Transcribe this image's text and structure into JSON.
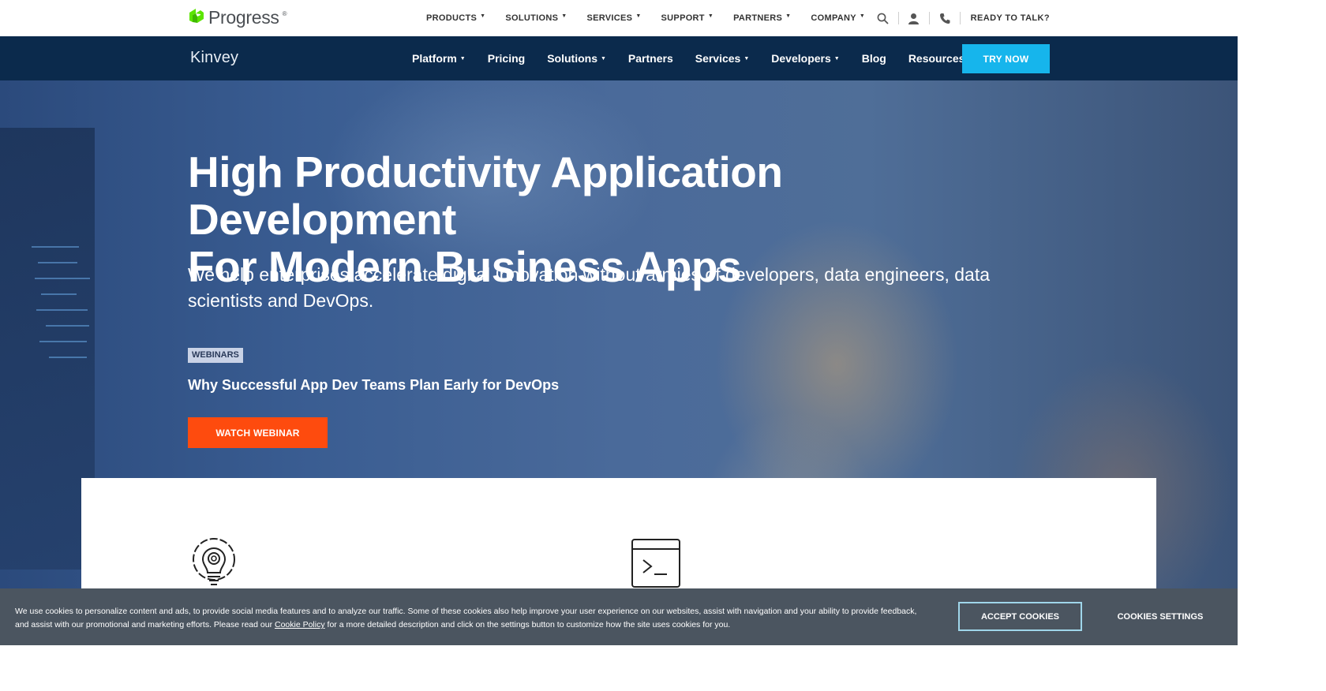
{
  "brand": {
    "logo_text": "Progress",
    "logo_mark": "®",
    "product_name": "Kinvey"
  },
  "top_nav": {
    "items": [
      {
        "label": "PRODUCTS"
      },
      {
        "label": "SOLUTIONS"
      },
      {
        "label": "SERVICES"
      },
      {
        "label": "SUPPORT"
      },
      {
        "label": "PARTNERS"
      },
      {
        "label": "COMPANY"
      }
    ],
    "icons": [
      "search-icon",
      "user-icon",
      "phone-icon"
    ],
    "ready_label": "READY TO TALK?"
  },
  "product_nav": {
    "items": [
      {
        "label": "Platform",
        "has_caret": true
      },
      {
        "label": "Pricing",
        "has_caret": false
      },
      {
        "label": "Solutions",
        "has_caret": true
      },
      {
        "label": "Partners",
        "has_caret": false
      },
      {
        "label": "Services",
        "has_caret": true
      },
      {
        "label": "Developers",
        "has_caret": true
      },
      {
        "label": "Blog",
        "has_caret": false
      },
      {
        "label": "Resources",
        "has_caret": true
      }
    ],
    "cta_label": "TRY NOW"
  },
  "hero": {
    "title_line1": "High Productivity Application Development",
    "title_line2": "For Modern Business Apps",
    "subtitle": "We help enterprises accelerate digital innovation without armies of developers, data engineers, data scientists and DevOps.",
    "badge": "WEBINARS",
    "webinar_title": "Why Successful App Dev Teams Plan Early for DevOps",
    "cta_label": "WATCH WEBINAR"
  },
  "cookie_banner": {
    "text_before_link": "We use cookies to personalize content and ads, to provide social media features and to analyze our traffic. Some of these cookies also help improve your user experience on our websites, assist with navigation and your ability to provide feedback, and assist with our promotional and marketing efforts. Please read our ",
    "link_text": "Cookie Policy",
    "text_after_link": " for a more detailed description and click on the settings button to customize how the site uses cookies for you.",
    "accept_label": "ACCEPT COOKIES",
    "settings_label": "COOKIES SETTINGS"
  },
  "colors": {
    "nav_background": "#0b2a4c",
    "try_now": "#16b5ec",
    "watch_webinar": "#fe4b0e",
    "brand_green": "#5ce500",
    "cookie_background": "#4b5560"
  },
  "card_icons": [
    "lightbulb-gear-icon",
    "terminal-window-icon"
  ]
}
